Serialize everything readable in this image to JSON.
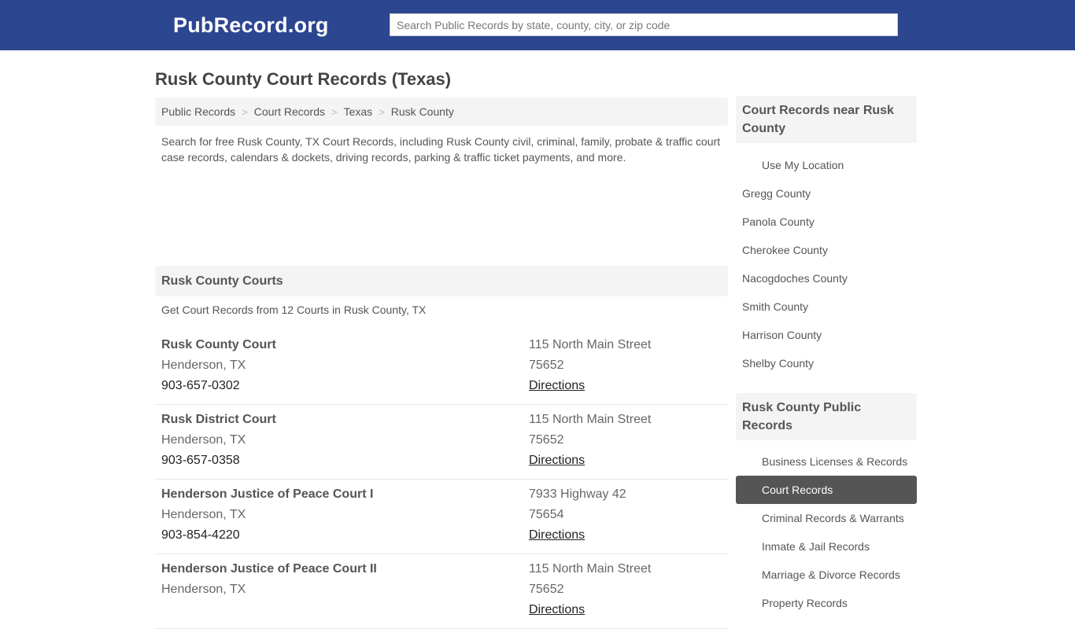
{
  "header": {
    "logo": "PubRecord.org",
    "search_placeholder": "Search Public Records by state, county, city, or zip code",
    "brand_color": "#2d4690"
  },
  "page_title": "Rusk County Court Records (Texas)",
  "breadcrumb": [
    "Public Records",
    "Court Records",
    "Texas",
    "Rusk County"
  ],
  "breadcrumb_separator": ">",
  "intro": "Search for free Rusk County, TX Court Records, including Rusk County civil, criminal, family, probate & traffic court case records, calendars & dockets, driving records, parking & traffic ticket payments, and more.",
  "courts_section": {
    "title": "Rusk County Courts",
    "subtitle": "Get Court Records from 12 Courts in Rusk County, TX",
    "directions_label": "Directions",
    "courts": [
      {
        "name": "Rusk County Court",
        "city": "Henderson, TX",
        "phone": "903-657-0302",
        "address": "115 North Main Street",
        "zip": "75652"
      },
      {
        "name": "Rusk District Court",
        "city": "Henderson, TX",
        "phone": "903-657-0358",
        "address": "115 North Main Street",
        "zip": "75652"
      },
      {
        "name": "Henderson Justice of Peace Court I",
        "city": "Henderson, TX",
        "phone": "903-854-4220",
        "address": "7933 Highway 42",
        "zip": "75654"
      },
      {
        "name": "Henderson Justice of Peace Court II",
        "city": "Henderson, TX",
        "phone": "",
        "address": "115 North Main Street",
        "zip": "75652"
      }
    ]
  },
  "sidebar": {
    "nearby": {
      "title": "Court Records near Rusk County",
      "use_location": "Use My Location",
      "counties": [
        "Gregg County",
        "Panola County",
        "Cherokee County",
        "Nacogdoches County",
        "Smith County",
        "Harrison County",
        "Shelby County"
      ]
    },
    "public_records": {
      "title": "Rusk County Public Records",
      "items": [
        {
          "label": "Business Licenses & Records",
          "active": false
        },
        {
          "label": "Court Records",
          "active": true
        },
        {
          "label": "Criminal Records & Warrants",
          "active": false
        },
        {
          "label": "Inmate & Jail Records",
          "active": false
        },
        {
          "label": "Marriage & Divorce Records",
          "active": false
        },
        {
          "label": "Property Records",
          "active": false
        }
      ]
    }
  }
}
